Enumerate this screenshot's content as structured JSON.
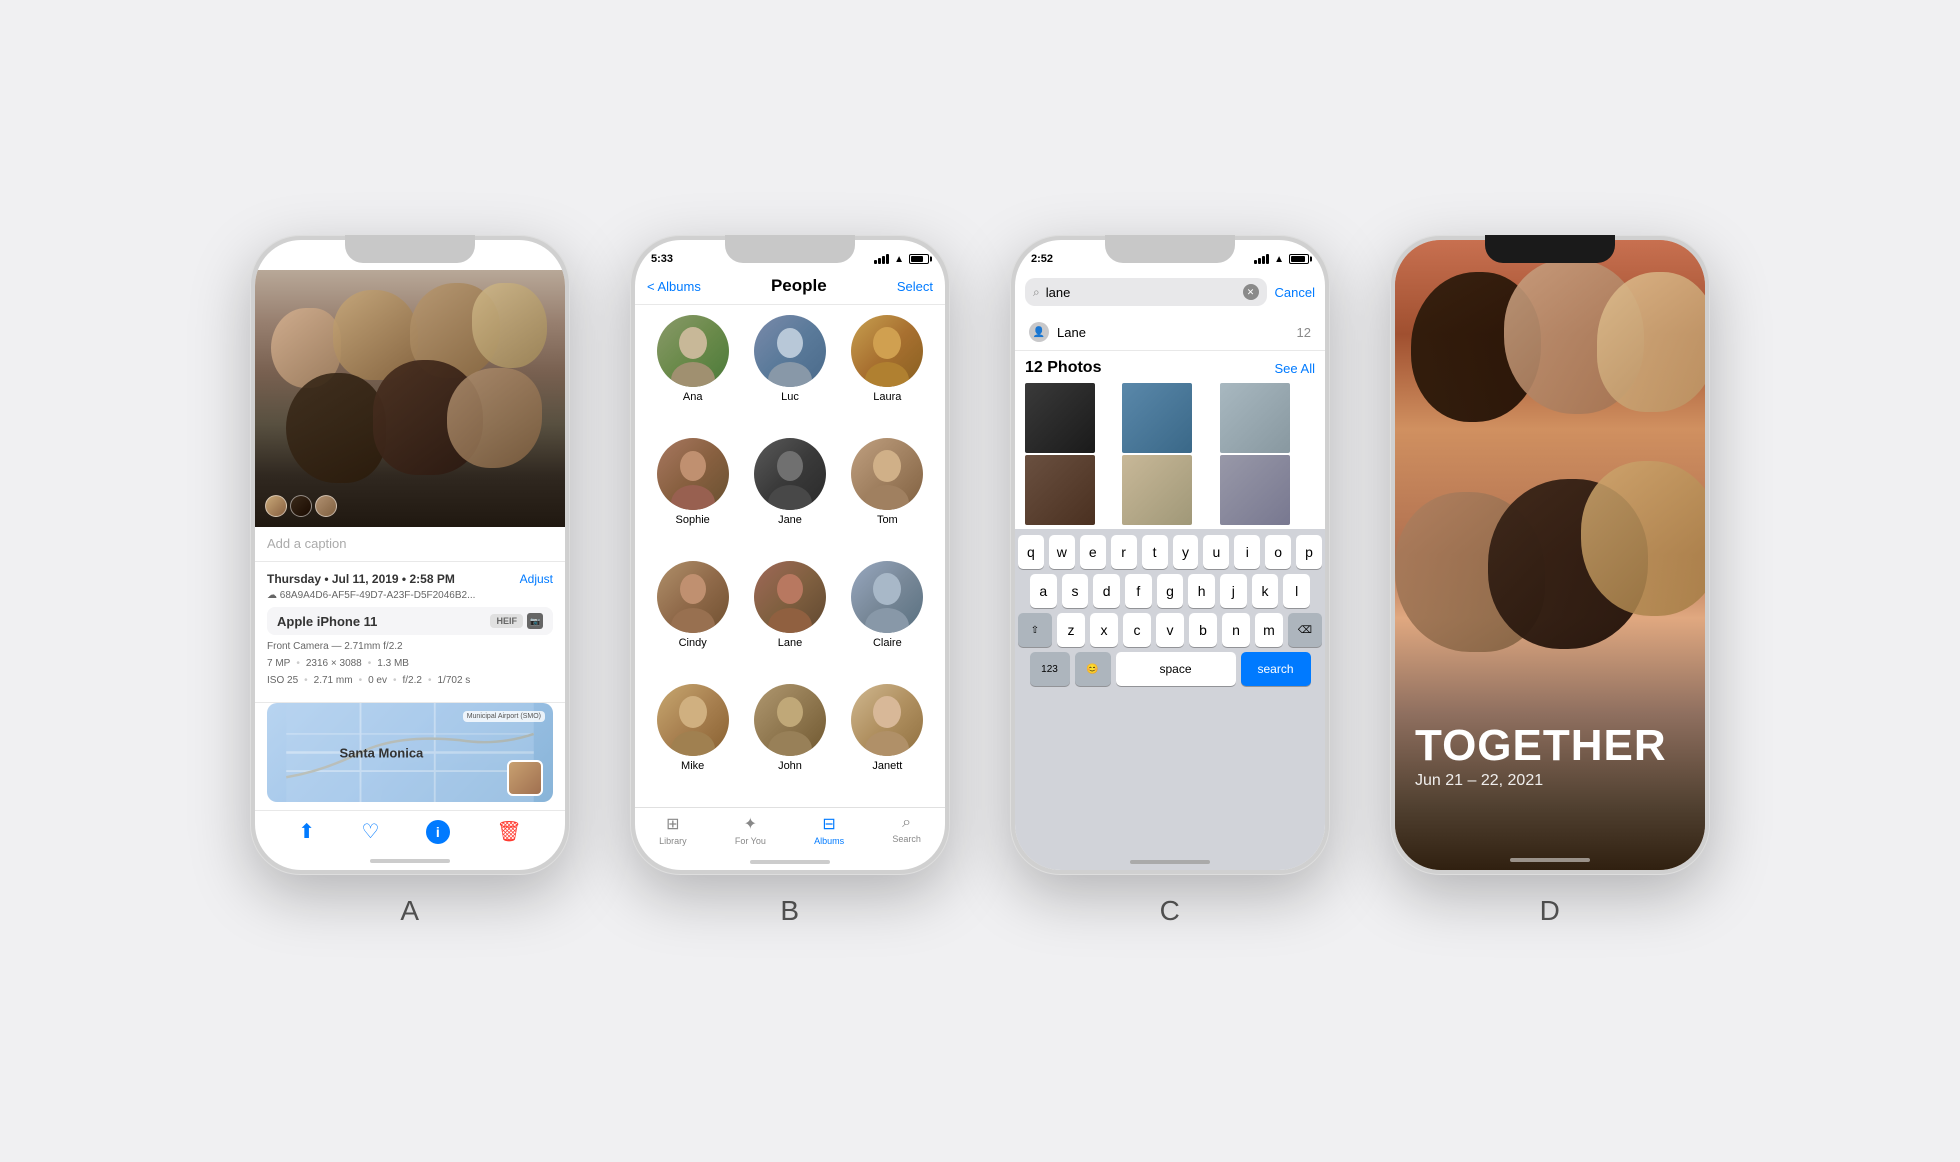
{
  "background": "#f0f0f2",
  "phones": {
    "labels": [
      "A",
      "B",
      "C",
      "D"
    ]
  },
  "phoneA": {
    "caption_placeholder": "Add a caption",
    "date": "Thursday • Jul 11, 2019 • 2:58 PM",
    "adjust": "Adjust",
    "cloud_id": "☁ 68A9A4D6-AF5F-49D7-A23F-D5F2046B2...",
    "device_name": "Apple iPhone 11",
    "badge_heif": "HEIF",
    "camera_label": "Front Camera — 2.71mm f/2.2",
    "exif1": "7 MP",
    "exif2": "2316 × 3088",
    "exif3": "1.3 MB",
    "exif_iso": "ISO 25",
    "exif_mm": "2.71 mm",
    "exif_ev": "0 ev",
    "exif_f": "f/2.2",
    "exif_shutter": "1/702 s",
    "map_label": "Santa Monica",
    "airport_label": "Municipal Airport (SMO)"
  },
  "phoneB": {
    "time": "5:33",
    "nav_back": "< Albums",
    "nav_title": "People",
    "nav_action": "Select",
    "people": [
      {
        "name": "Ana",
        "av": "av-ana"
      },
      {
        "name": "Luc",
        "av": "av-luc"
      },
      {
        "name": "Laura",
        "av": "av-laura"
      },
      {
        "name": "Sophie",
        "av": "av-sophie"
      },
      {
        "name": "Jane",
        "av": "av-jane"
      },
      {
        "name": "Tom",
        "av": "av-tom"
      },
      {
        "name": "Cindy",
        "av": "av-cindy"
      },
      {
        "name": "Lane",
        "av": "av-lane"
      },
      {
        "name": "Claire",
        "av": "av-claire"
      },
      {
        "name": "Mike",
        "av": "av-mike"
      },
      {
        "name": "John",
        "av": "av-john"
      },
      {
        "name": "Janett",
        "av": "av-janett"
      }
    ],
    "tabs": [
      "Library",
      "For You",
      "Albums",
      "Search"
    ],
    "active_tab": "Albums"
  },
  "phoneC": {
    "time": "2:52",
    "search_text": "lane",
    "cancel_label": "Cancel",
    "suggestion_name": "Lane",
    "suggestion_count": "12",
    "photos_title": "12 Photos",
    "see_all": "See All",
    "keyboard_rows": [
      [
        "q",
        "w",
        "e",
        "r",
        "t",
        "y",
        "u",
        "i",
        "o",
        "p"
      ],
      [
        "a",
        "s",
        "d",
        "f",
        "g",
        "h",
        "j",
        "k",
        "l"
      ],
      [
        "z",
        "x",
        "c",
        "v",
        "b",
        "n",
        "m"
      ],
      [
        "123",
        "😊",
        "space",
        "search"
      ]
    ]
  },
  "phoneD": {
    "together_text": "TOGETHER",
    "date_text": "Jun 21 – 22, 2021"
  }
}
